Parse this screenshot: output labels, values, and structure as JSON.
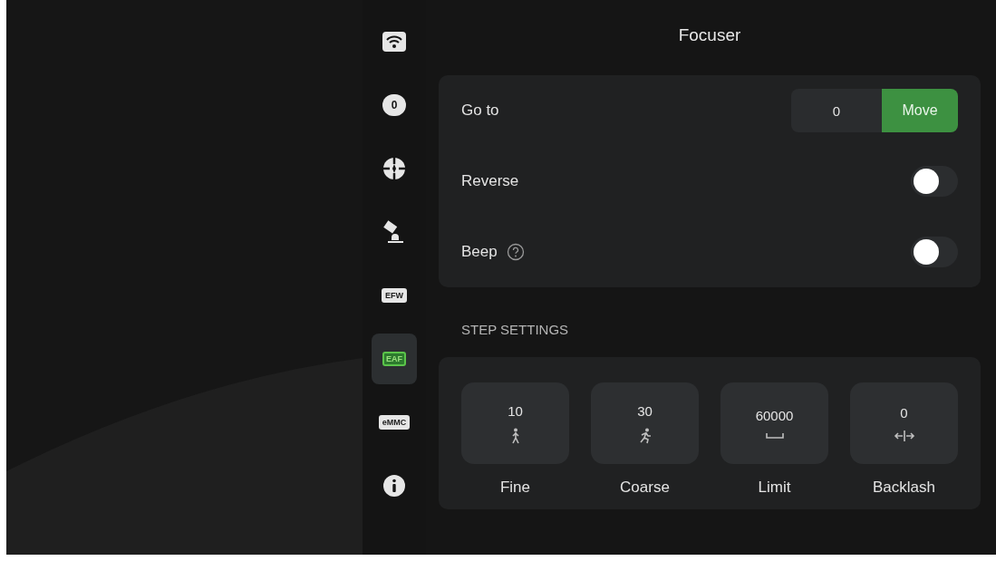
{
  "sidebar": {
    "items": [
      {
        "kind": "wifi",
        "selected": false
      },
      {
        "kind": "camera",
        "label": "0",
        "selected": false
      },
      {
        "kind": "guide",
        "selected": false
      },
      {
        "kind": "mount",
        "selected": false
      },
      {
        "kind": "efw",
        "label": "EFW",
        "selected": false
      },
      {
        "kind": "eaf",
        "label": "EAF",
        "selected": true
      },
      {
        "kind": "emmc",
        "label": "eMMC",
        "selected": false
      },
      {
        "kind": "info",
        "selected": false
      }
    ]
  },
  "title": "Focuser",
  "settings": [
    {
      "kind": "goto",
      "label": "Go to",
      "value": "0",
      "button": "Move"
    },
    {
      "kind": "toggle",
      "label": "Reverse",
      "on": false,
      "help": false
    },
    {
      "kind": "toggle",
      "label": "Beep",
      "on": false,
      "help": true
    }
  ],
  "step_settings": {
    "heading": "STEP SETTINGS",
    "items": [
      {
        "kind": "fine",
        "value": "10",
        "label": "Fine"
      },
      {
        "kind": "coarse",
        "value": "30",
        "label": "Coarse"
      },
      {
        "kind": "limit",
        "value": "60000",
        "label": "Limit"
      },
      {
        "kind": "backlash",
        "value": "0",
        "label": "Backlash"
      }
    ]
  }
}
